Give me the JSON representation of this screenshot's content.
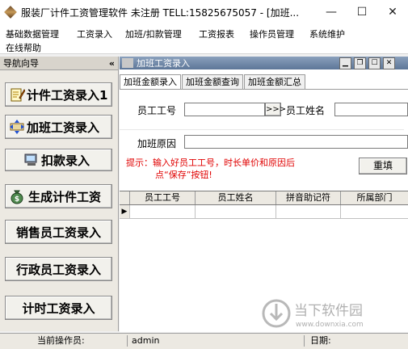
{
  "window": {
    "title": "服装厂计件工资管理软件 未注册 TELL:15825675057 - [加班...",
    "minimize_glyph": "—",
    "maximize_glyph": "☐",
    "close_glyph": "✕"
  },
  "menubar": {
    "items": [
      "基础数据管理",
      "工资录入",
      "加班/扣款管理",
      "工资报表",
      "操作员管理",
      "系统维护",
      "在线帮助"
    ]
  },
  "nav": {
    "title": "导航向导",
    "collapse_glyph": "«",
    "buttons": [
      {
        "label": "计件工资录入1",
        "icon": "pencil-paper-icon"
      },
      {
        "label": "加班工资录入",
        "icon": "arrows-compress-icon"
      },
      {
        "label": "扣款录入",
        "icon": "computer-icon"
      },
      {
        "label": "生成计件工资",
        "icon": "money-bag-icon"
      },
      {
        "label": "销售员工资录入",
        "icon": ""
      },
      {
        "label": "行政员工资录入",
        "icon": ""
      },
      {
        "label": "计时工资录入",
        "icon": ""
      }
    ]
  },
  "child_window": {
    "title": "加班工资录入",
    "tabs": [
      "加班金额录入",
      "加班金额查询",
      "加班金额汇总"
    ],
    "active_tab": 0,
    "form": {
      "emp_id_label": "员工工号",
      "emp_id_value": "",
      "lookup_button": ">>>",
      "emp_name_label": "员工姓名",
      "emp_name_value": "",
      "reason_label": "加班原因",
      "reason_value": "",
      "hint_line1": "提示：输入好员工工号，时长单价和原因后",
      "hint_line2": "点“保存”按钮!",
      "reset_button": "重填"
    },
    "grid": {
      "columns": [
        "员工工号",
        "员工姓名",
        "拼音助记符",
        "所属部门"
      ],
      "row_indicator": "▶"
    }
  },
  "status": {
    "operator_label": "当前操作员:",
    "operator_value": "admin",
    "date_label": "日期:",
    "date_value": ""
  },
  "watermark": {
    "text": "当下软件园",
    "url": "www.downxia.com"
  }
}
